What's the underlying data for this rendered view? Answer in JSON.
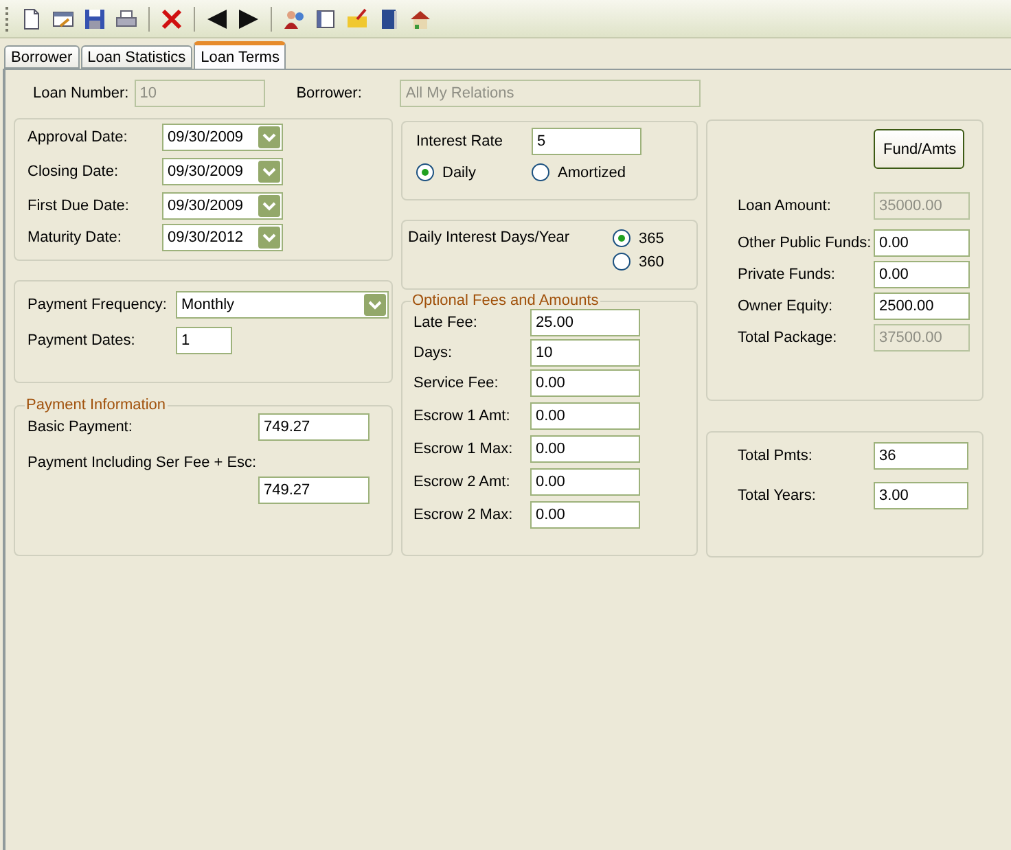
{
  "tabs": [
    {
      "label": "Borrower",
      "selected": false
    },
    {
      "label": "Loan Statistics",
      "selected": false
    },
    {
      "label": "Loan Terms",
      "selected": true
    }
  ],
  "header": [
    {
      "label": "Loan Number:",
      "value": "10",
      "disabled": true
    },
    {
      "label": "Borrower:",
      "value": "All My Relations",
      "disabled": true
    }
  ],
  "dates": [
    {
      "label": "Approval Date:",
      "value": "09/30/2009"
    },
    {
      "label": "Closing Date:",
      "value": "09/30/2009"
    },
    {
      "label": "First Due Date:",
      "value": "09/30/2009"
    },
    {
      "label": "Maturity Date:",
      "value": "09/30/2012"
    }
  ],
  "payment": [
    {
      "label": "Payment Frequency:",
      "value": "Monthly",
      "kind": "combo"
    },
    {
      "label": "Payment Dates:",
      "value": "1",
      "kind": "text"
    }
  ],
  "payment_information": {
    "title": "Payment Information",
    "fields": [
      {
        "label": "Basic Payment:",
        "value": "749.27",
        "kind": "inline"
      },
      {
        "label": "Payment Including Ser Fee + Esc:",
        "value": "749.27",
        "kind": "stacked"
      }
    ]
  },
  "interest": {
    "label": "Interest Rate",
    "value": "5",
    "options": [
      {
        "label": "Daily",
        "selected": true
      },
      {
        "label": "Amortized",
        "selected": false
      }
    ]
  },
  "days_per_year": {
    "label": "Daily Interest Days/Year",
    "options": [
      {
        "label": "365",
        "selected": true
      },
      {
        "label": "360",
        "selected": false
      }
    ]
  },
  "optional_fees": {
    "title": "Optional Fees and Amounts",
    "fields": [
      {
        "label": "Late Fee:",
        "value": "25.00"
      },
      {
        "label": "Days:",
        "value": "10"
      },
      {
        "label": "Service Fee:",
        "value": "0.00"
      },
      {
        "label": "Escrow 1 Amt:",
        "value": "0.00"
      },
      {
        "label": "Escrow 1 Max:",
        "value": "0.00"
      },
      {
        "label": "Escrow 2 Amt:",
        "value": "0.00"
      },
      {
        "label": "Escrow 2 Max:",
        "value": "0.00"
      }
    ]
  },
  "funds": {
    "button": "Fund/Amts",
    "fields": [
      {
        "label": "Loan Amount:",
        "value": "35000.00",
        "disabled": true
      },
      {
        "label": "Other Public Funds:",
        "value": "0.00",
        "disabled": false
      },
      {
        "label": "Private Funds:",
        "value": "0.00",
        "disabled": false
      },
      {
        "label": "Owner Equity:",
        "value": "2500.00",
        "disabled": false
      },
      {
        "label": "Total Package:",
        "value": "37500.00",
        "disabled": true
      }
    ]
  },
  "totals": [
    {
      "label": "Total Pmts:",
      "value": "36"
    },
    {
      "label": "Total Years:",
      "value": "3.00"
    }
  ]
}
